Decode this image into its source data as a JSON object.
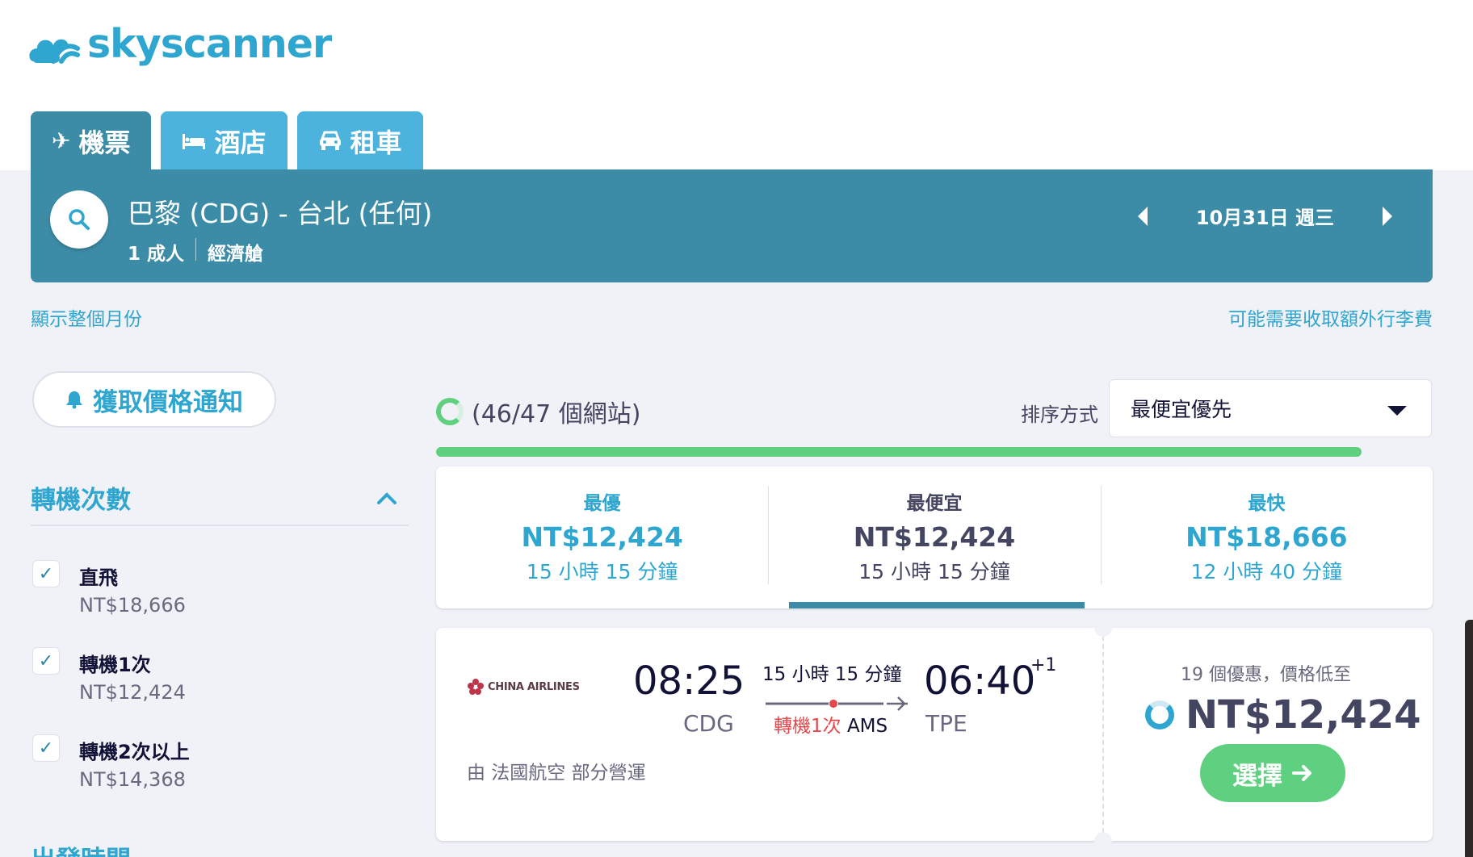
{
  "brand": {
    "name": "skyscanner"
  },
  "tabs": [
    {
      "label": "機票",
      "icon": "plane-icon"
    },
    {
      "label": "酒店",
      "icon": "bed-icon"
    },
    {
      "label": "租車",
      "icon": "car-icon"
    }
  ],
  "search": {
    "route": "巴黎 (CDG) - 台北 (任何)",
    "passengers": "1 成人",
    "cabin": "經濟艙",
    "date": "10月31日 週三"
  },
  "links": {
    "show_month": "顯示整個月份",
    "baggage_fee": "可能需要收取額外行李費"
  },
  "price_alert": {
    "label": "獲取價格通知"
  },
  "filters": {
    "stops": {
      "title": "轉機次數",
      "items": [
        {
          "label": "直飛",
          "price": "NT$18,666",
          "checked": true
        },
        {
          "label": "轉機1次",
          "price": "NT$12,424",
          "checked": true
        },
        {
          "label": "轉機2次以上",
          "price": "NT$14,368",
          "checked": true
        }
      ]
    },
    "departure": {
      "title": "出發時間"
    }
  },
  "results_header": {
    "progress_text": "(46/47 個網站)",
    "progress_fraction": 0.98,
    "sort_label": "排序方式",
    "sort_value": "最便宜優先"
  },
  "summary": [
    {
      "head": "最優",
      "price": "NT$12,424",
      "duration": "15 小時 15 分鐘"
    },
    {
      "head": "最便宜",
      "price": "NT$12,424",
      "duration": "15 小時 15 分鐘",
      "active": true
    },
    {
      "head": "最快",
      "price": "NT$18,666",
      "duration": "12 小時 40 分鐘"
    }
  ],
  "result": {
    "airline": "CHINA AIRLINES",
    "dep_time": "08:25",
    "dep_code": "CDG",
    "duration": "15 小時 15 分鐘",
    "stops_text": "轉機1次",
    "stop_hub": "AMS",
    "arr_time": "06:40",
    "plus_day": "+1",
    "arr_code": "TPE",
    "operated_by": "由 法國航空 部分營運",
    "deals_text": "19 個優惠，價格低至",
    "price": "NT$12,424",
    "select_label": "選擇"
  },
  "colors": {
    "brand": "#2ea6cf",
    "tab_active": "#3c8ca8",
    "tab": "#4bb3dc",
    "green": "#5fcf80",
    "stop_red": "#e5464b"
  }
}
